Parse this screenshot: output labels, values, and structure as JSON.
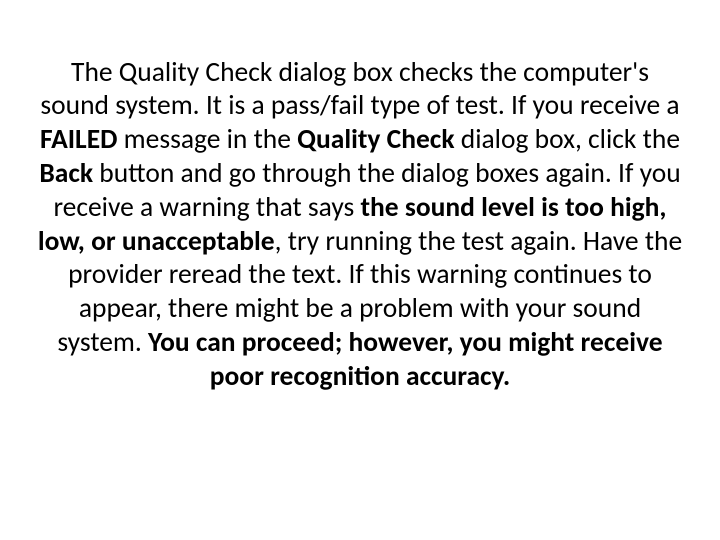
{
  "content": {
    "t0": "The Quality Check dialog box checks the computer's sound system. It is a pass/fail type of test. If you receive a ",
    "t1": "FAILED",
    "t2": " message in the ",
    "t3": "Quality Check",
    "t4": " dialog box, click the ",
    "t5": "Back",
    "t6": " button and go through the dialog boxes again. If you receive a warning that says ",
    "t7": "the sound level is too high, low, or unacceptable",
    "t8": ", try running the test again. Have the provider reread the text. If this warning continues to appear, there might be a problem with your sound system. ",
    "t9": "You can proceed; however, you might receive poor recognition accuracy."
  }
}
